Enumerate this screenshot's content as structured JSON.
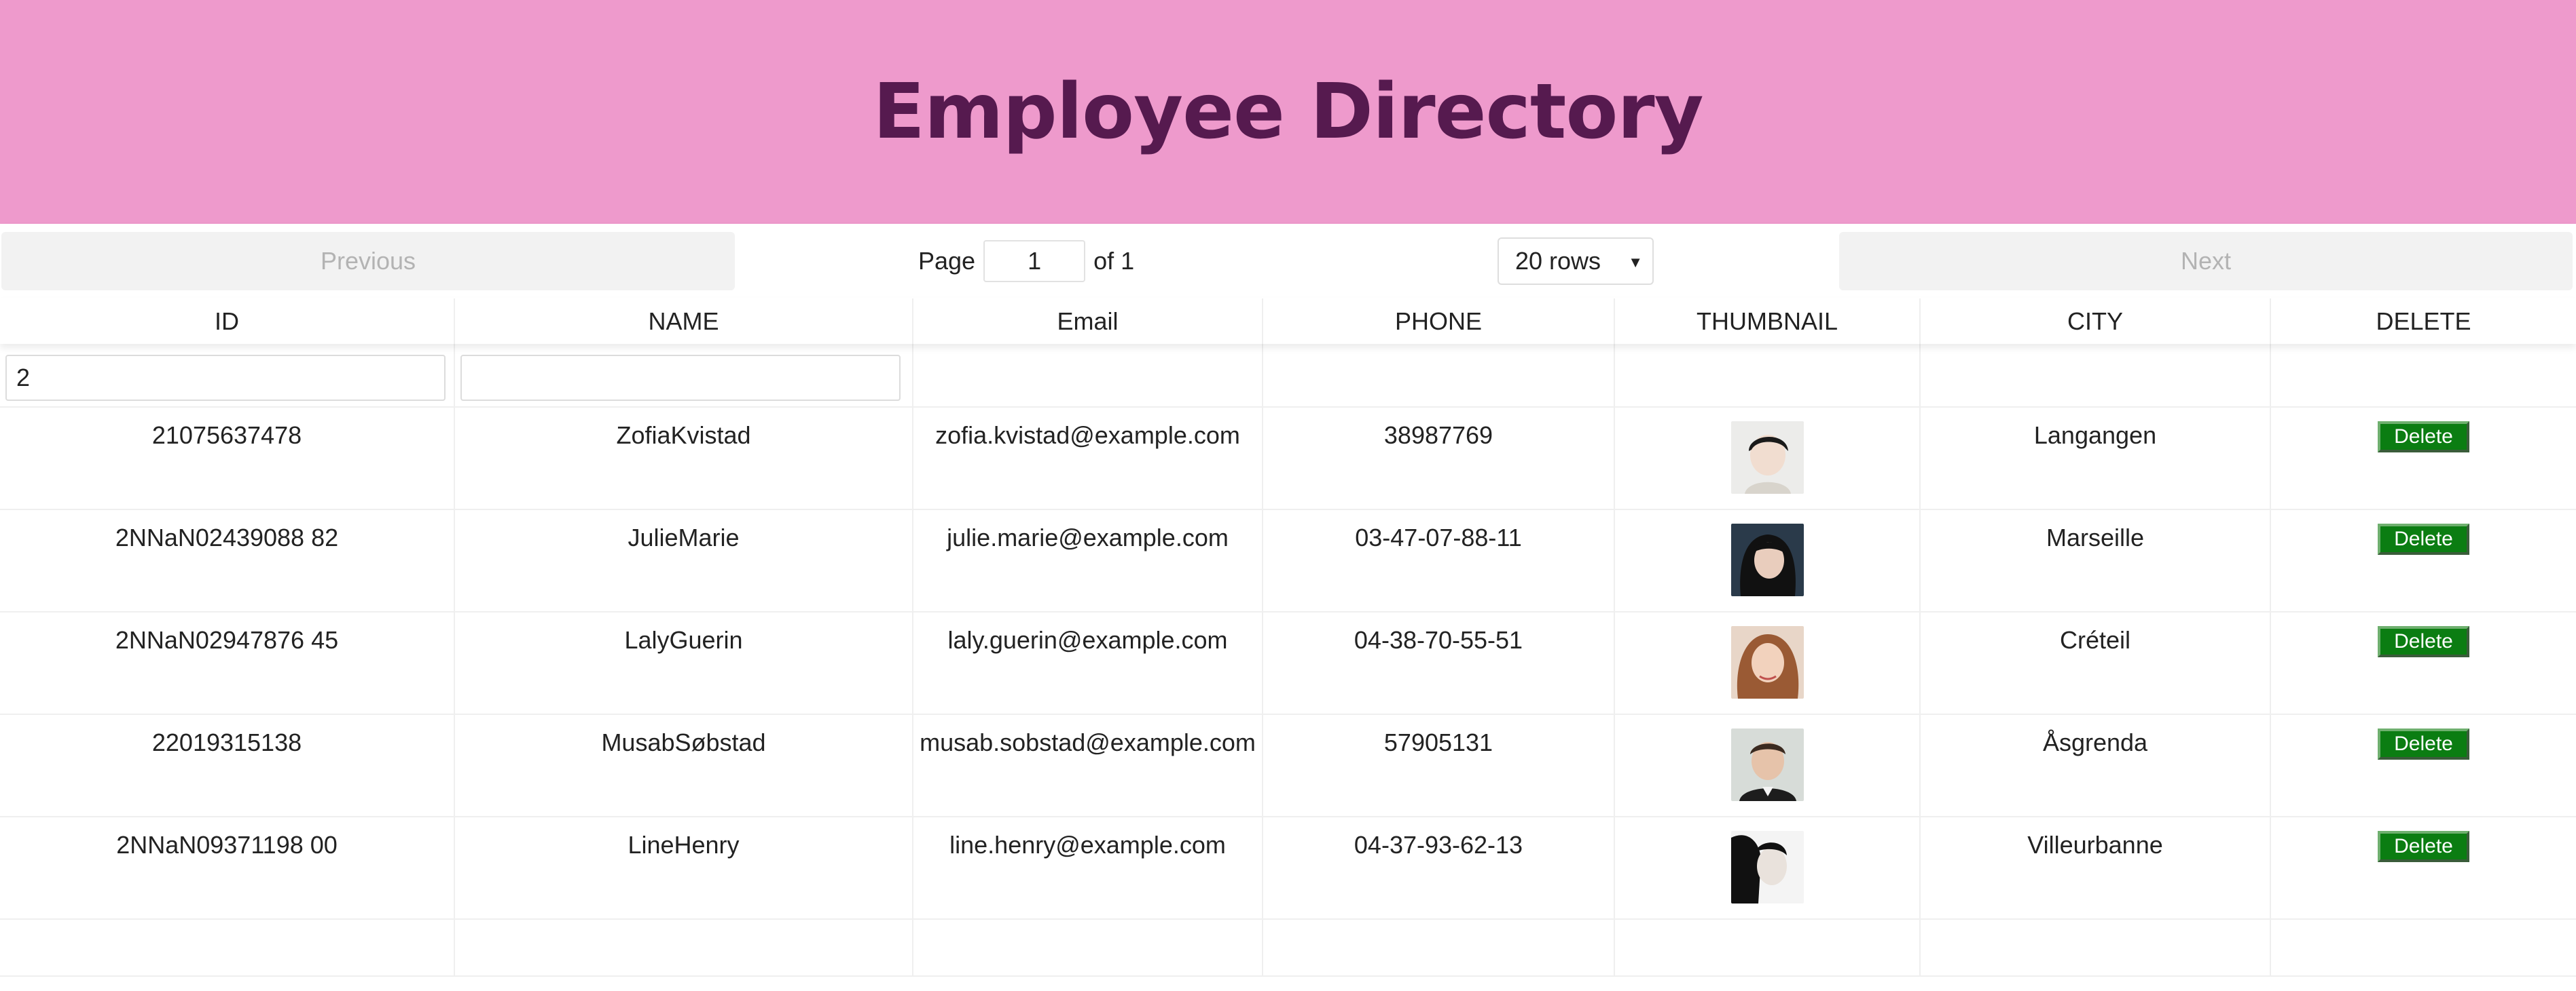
{
  "header": {
    "title": "Employee Directory",
    "bg_color": "#ee9acc",
    "title_color": "#561a4f"
  },
  "pager": {
    "previous_label": "Previous",
    "next_label": "Next",
    "page_label": "Page",
    "page_value": "1",
    "of_label": "of 1",
    "rows_selected": "20 rows"
  },
  "columns": [
    "ID",
    "NAME",
    "Email",
    "PHONE",
    "THUMBNAIL",
    "CITY",
    "DELETE"
  ],
  "filters": {
    "id_value": "2",
    "name_value": ""
  },
  "rows": [
    {
      "id": "21075637478",
      "name": "ZofiaKvistad",
      "email": "zofia.kvistad@example.com",
      "phone": "38987769",
      "city": "Langangen",
      "delete_label": "Delete"
    },
    {
      "id": "2NNaN02439088 82",
      "name": "JulieMarie",
      "email": "julie.marie@example.com",
      "phone": "03-47-07-88-11",
      "city": "Marseille",
      "delete_label": "Delete"
    },
    {
      "id": "2NNaN02947876 45",
      "name": "LalyGuerin",
      "email": "laly.guerin@example.com",
      "phone": "04-38-70-55-51",
      "city": "Créteil",
      "delete_label": "Delete"
    },
    {
      "id": "22019315138",
      "name": "MusabSøbstad",
      "email": "musab.sobstad@example.com",
      "phone": "57905131",
      "city": "Åsgrenda",
      "delete_label": "Delete"
    },
    {
      "id": "2NNaN09371198 00",
      "name": "LineHenry",
      "email": "line.henry@example.com",
      "phone": "04-37-93-62-13",
      "city": "Villeurbanne",
      "delete_label": "Delete"
    }
  ],
  "delete_color": "#0b7d12"
}
